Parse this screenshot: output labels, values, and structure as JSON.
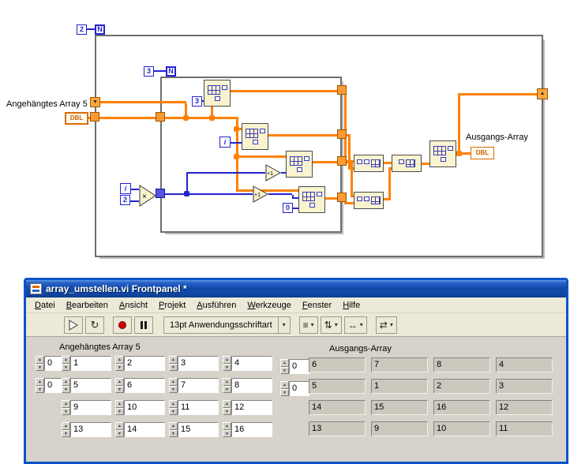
{
  "diagram": {
    "outer_loop": {
      "count_value": "2",
      "count_label": "N",
      "iterator": "i"
    },
    "inner_loop": {
      "count_value": "3",
      "count_label": "N",
      "iterator": "i"
    },
    "input": {
      "label": "Angehängtes Array 5",
      "terminal": "DBL"
    },
    "output": {
      "label": "Ausgangs-Array",
      "terminal": "DBL"
    },
    "constants": {
      "index_top": "3",
      "index_bottom": "0",
      "multiplier": "2"
    },
    "functions": {
      "multiply": "×",
      "increment_upper": "+1",
      "increment_lower": "+1"
    },
    "colors": {
      "wire_array": "#ff8200",
      "wire_integer": "#2323cf"
    }
  },
  "icons": {
    "spinner_up": "▲",
    "spinner_down": "▼",
    "sr_left": "▼",
    "sr_right": "▲",
    "run_continuous": "↻",
    "dropdown_arrow": "▾",
    "align": "≡",
    "distribute": "⇅",
    "reorder": "⇄",
    "resize": "↔"
  },
  "window": {
    "title": "array_umstellen.vi Frontpanel *",
    "menu": [
      "Datei",
      "Bearbeiten",
      "Ansicht",
      "Projekt",
      "Ausführen",
      "Werkzeuge",
      "Fenster",
      "Hilfe"
    ],
    "toolbar": {
      "font_selector": "13pt Anwendungsschriftart"
    },
    "panel": {
      "input_array": {
        "label": "Angehängtes Array 5",
        "index_values": [
          "0",
          "0"
        ],
        "rows": [
          [
            "1",
            "2",
            "3",
            "4"
          ],
          [
            "5",
            "6",
            "7",
            "8"
          ],
          [
            "9",
            "10",
            "11",
            "12"
          ],
          [
            "13",
            "14",
            "15",
            "16"
          ]
        ]
      },
      "output_array": {
        "label": "Ausgangs-Array",
        "index_values": [
          "0",
          "0"
        ],
        "rows": [
          [
            "6",
            "7",
            "8",
            "4"
          ],
          [
            "5",
            "1",
            "2",
            "3"
          ],
          [
            "14",
            "15",
            "16",
            "12"
          ],
          [
            "13",
            "9",
            "10",
            "11"
          ]
        ]
      }
    }
  }
}
